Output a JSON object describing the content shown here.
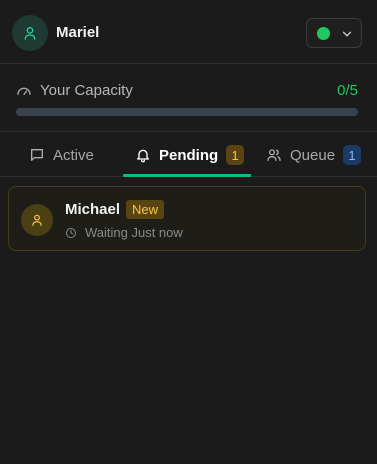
{
  "header": {
    "user_name": "Mariel",
    "avatar_icon": "user-icon",
    "status": {
      "color": "#22c55e",
      "icon": "chevron-down-icon"
    }
  },
  "capacity": {
    "label": "Your Capacity",
    "value_text": "0/5",
    "current": 0,
    "max": 5,
    "icon": "gauge-icon"
  },
  "tabs": [
    {
      "label": "Active",
      "icon": "message-square-icon",
      "badge": "",
      "selected": false
    },
    {
      "label": "Pending",
      "icon": "bell-icon",
      "badge": "1",
      "selected": true
    },
    {
      "label": "Queue",
      "icon": "users-icon",
      "badge": "1",
      "selected": false
    }
  ],
  "pending_list": [
    {
      "name": "Michael",
      "tag": "New",
      "status_text": "Waiting Just now",
      "icon": "user-icon",
      "meta_icon": "clock-icon"
    }
  ],
  "colors": {
    "accent_green": "#22c55e",
    "tab_underline": "#10b981",
    "amber": "#f5c44a",
    "blue_badge": "#8db8f5"
  }
}
